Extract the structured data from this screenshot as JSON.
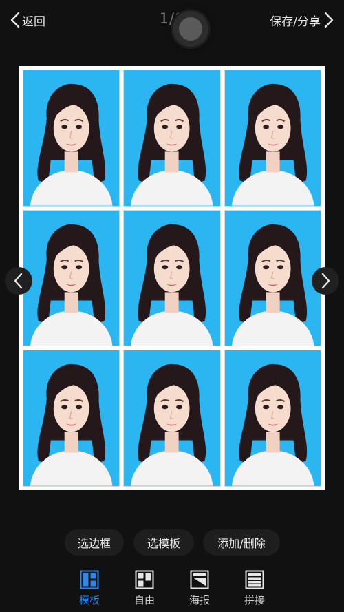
{
  "header": {
    "back_label": "返回",
    "counter": "1/8",
    "save_label": "保存/分享"
  },
  "photo_sheet": {
    "layout": "3x3",
    "photo_count": 9,
    "background_color": "#2bb6f2"
  },
  "actions": [
    {
      "label": "选边框"
    },
    {
      "label": "选模板"
    },
    {
      "label": "添加/删除"
    }
  ],
  "tabs": [
    {
      "label": "模板",
      "icon": "template-icon",
      "active": true
    },
    {
      "label": "自由",
      "icon": "free-layout-icon",
      "active": false
    },
    {
      "label": "海报",
      "icon": "poster-icon",
      "active": false
    },
    {
      "label": "拼接",
      "icon": "stitch-icon",
      "active": false
    }
  ],
  "colors": {
    "accent": "#2f86e8",
    "background": "#111111",
    "photo_background": "#2bb6f2"
  }
}
